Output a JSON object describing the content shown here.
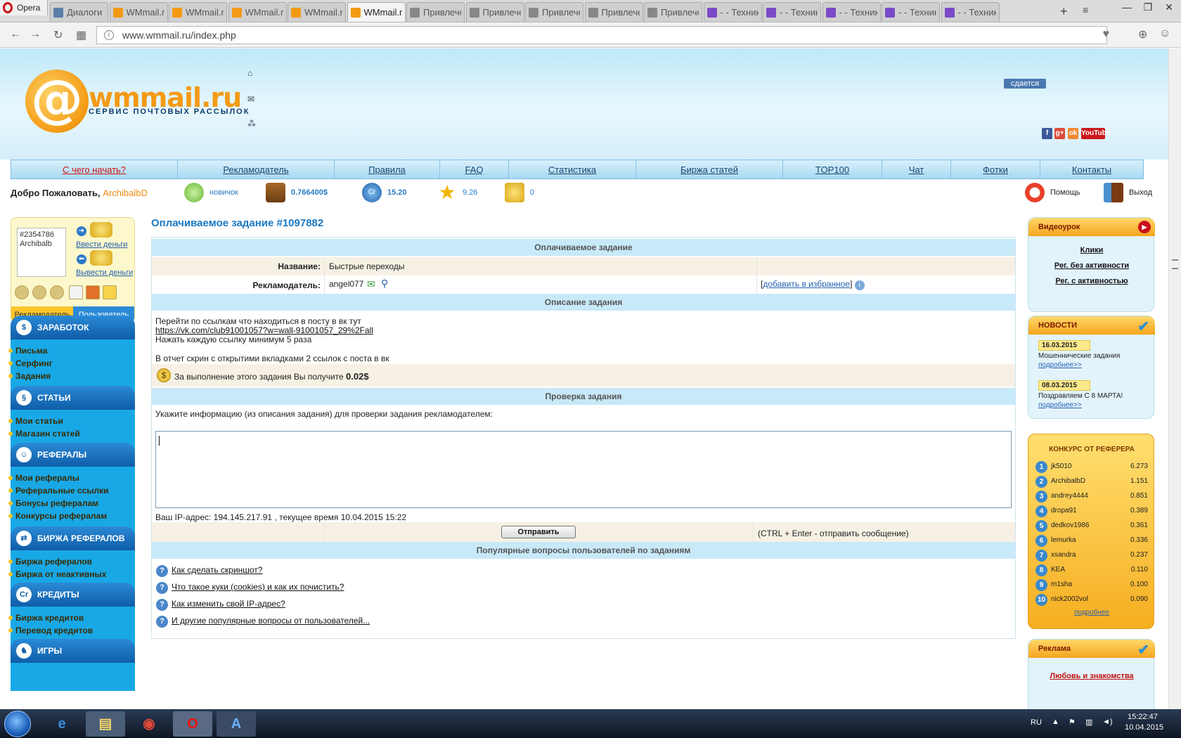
{
  "browser": {
    "menu_label": "Opera",
    "tabs": [
      {
        "label": "Диалоги",
        "icon": "vk-icon",
        "active": false
      },
      {
        "label": "WMmail.ru",
        "icon": "wmmail-icon",
        "active": false
      },
      {
        "label": "WMmail.ru",
        "icon": "wmmail-icon",
        "active": false
      },
      {
        "label": "WMmail.ru",
        "icon": "wmmail-icon",
        "active": false
      },
      {
        "label": "WMmail.ru",
        "icon": "wmmail-icon",
        "active": false
      },
      {
        "label": "WMmail.ru",
        "icon": "wmmail-icon",
        "active": true
      },
      {
        "label": "Привлечение",
        "icon": "page-icon",
        "active": false
      },
      {
        "label": "Привлечение",
        "icon": "page-icon",
        "active": false
      },
      {
        "label": "Привлечение",
        "icon": "page-icon",
        "active": false
      },
      {
        "label": "Привлечение",
        "icon": "page-icon",
        "active": false
      },
      {
        "label": "Привлечение",
        "icon": "page-icon",
        "active": false
      },
      {
        "label": "- - Техника",
        "icon": "diamond-icon",
        "active": false
      },
      {
        "label": "- - Техника",
        "icon": "diamond-icon",
        "active": false
      },
      {
        "label": "- - Техника",
        "icon": "diamond-icon",
        "active": false
      },
      {
        "label": "- - Техника",
        "icon": "diamond-icon",
        "active": false
      },
      {
        "label": "- - Техника",
        "icon": "diamond-icon",
        "active": false
      }
    ],
    "url": "www.wmmail.ru/index.php"
  },
  "header": {
    "logo_text": "wmmail.ru",
    "logo_sub": "СЕРВИС ПОЧТОВЫХ РАССЫЛОК",
    "rent_label": "сдается",
    "social": [
      "f",
      "g+",
      "ok",
      "YouTube"
    ]
  },
  "menu": [
    "С чего начать?",
    "Рекламодатель",
    "Правила",
    "FAQ",
    "Статистика",
    "Биржа статей",
    "TOP100",
    "Чат",
    "Фотки",
    "Контакты"
  ],
  "welcome": {
    "text": "Добро Пожаловать,",
    "username": "ArchibalbD",
    "stats": {
      "rank": "новичок",
      "balance": "0.766400$",
      "credits": "15.20",
      "rating": "9.26",
      "coins": "0"
    },
    "help": "Помощь",
    "logout": "Выход"
  },
  "userbox": {
    "avatar_alt": "#2354786 Archibalb",
    "deposit": "Ввести деньги",
    "withdraw": "Вывести деньги",
    "tab_advertiser": "Рекламодатель",
    "tab_user": "Пользователь"
  },
  "leftnav": [
    {
      "title": "ЗАРАБОТОК",
      "icon": "$",
      "items": [
        "Письма",
        "Серфинг",
        "Задания"
      ]
    },
    {
      "title": "СТАТЬИ",
      "icon": "§",
      "items": [
        "Мои статьи",
        "Магазин статей"
      ]
    },
    {
      "title": "РЕФЕРАЛЫ",
      "icon": "☺",
      "items": [
        "Мои рефералы",
        "Реферальные ссылки",
        "Бонусы рефералам",
        "Конкурсы рефералам"
      ]
    },
    {
      "title": "БИРЖА РЕФЕРАЛОВ",
      "icon": "⇄",
      "items": [
        "Биржа рефералов",
        "Биржа от неактивных"
      ]
    },
    {
      "title": "КРЕДИТЫ",
      "icon": "Cr",
      "items": [
        "Биржа кредитов",
        "Перевод кредитов"
      ]
    },
    {
      "title": "ИГРЫ",
      "icon": "♞",
      "items": []
    }
  ],
  "task": {
    "title": "Оплачиваемое задание #1097882",
    "section_title": "Оплачиваемое задание",
    "name_label": "Название:",
    "name_value": "Быстрые переходы",
    "advertiser_label": "Рекламодатель:",
    "advertiser_value": "angel077",
    "favorite_link": "добавить в избранное",
    "desc_title": "Описание задания",
    "desc_line1": "Перейти по ссылкам что находиться в посту в вк тут",
    "desc_link": "https://vk.com/club91001057?w=wall-91001057_29%2Fall",
    "desc_line2": "Нажать каждую ссылку минимум 5 раза",
    "desc_line3": "В отчет скрин с открытими вкладками 2 ссылок с поста в вк",
    "reward_text": "За выполнение этого задания Вы получите",
    "reward_value": "0.02$",
    "check_title": "Проверка задания",
    "check_hint": "Укажите информацию (из описания задания) для проверки задания рекламодателем:",
    "ip_text": "Ваш IP-адрес: 194.145.217.91 , текущее время 10.04.2015 15:22",
    "send_button": "Отправить",
    "send_hint": "(CTRL + Enter - отправить сообщение)",
    "faq_title": "Популярные вопросы пользователей по заданиям",
    "faq": [
      "Как сделать скриншот?",
      "Что такое куки (cookies) и как их почистить?",
      "Как изменить свой IP-адрес?",
      "И другие популярные вопросы от пользователей..."
    ]
  },
  "right": {
    "video_title": "Видеоурок",
    "video_links": [
      "Клики",
      "Рег. без активности",
      "Рег. с активностью"
    ],
    "news_title": "НОВОСТИ",
    "news": [
      {
        "date": "16.03.2015",
        "text": "Мошеннические задания",
        "more": "подробнее>>"
      },
      {
        "date": "08.03.2015",
        "text": "Поздравляем С 8 МАРТА!",
        "more": "подробнее>>"
      }
    ],
    "contest_title": "КОНКУРС ОТ РЕФЕРЕРА",
    "contest": [
      {
        "n": "1",
        "name": "jk5010",
        "score": "6.273"
      },
      {
        "n": "2",
        "name": "ArchibalbD",
        "score": "1.151"
      },
      {
        "n": "3",
        "name": "andrey4444",
        "score": "0.851"
      },
      {
        "n": "4",
        "name": "dropa91",
        "score": "0.389"
      },
      {
        "n": "5",
        "name": "dedkov1986",
        "score": "0.361"
      },
      {
        "n": "6",
        "name": "lemurka",
        "score": "0.336"
      },
      {
        "n": "7",
        "name": "xsandra",
        "score": "0.237"
      },
      {
        "n": "8",
        "name": "KEA",
        "score": "0.110"
      },
      {
        "n": "9",
        "name": "m1sha",
        "score": "0.100"
      },
      {
        "n": "10",
        "name": "nick2002vol",
        "score": "0.090"
      }
    ],
    "contest_more": "подробнее",
    "ads_title": "Реклама",
    "ads_link": "Любовь и знакомства"
  },
  "taskbar": {
    "lang": "RU",
    "time": "15:22:47",
    "date": "10.04.2015"
  }
}
